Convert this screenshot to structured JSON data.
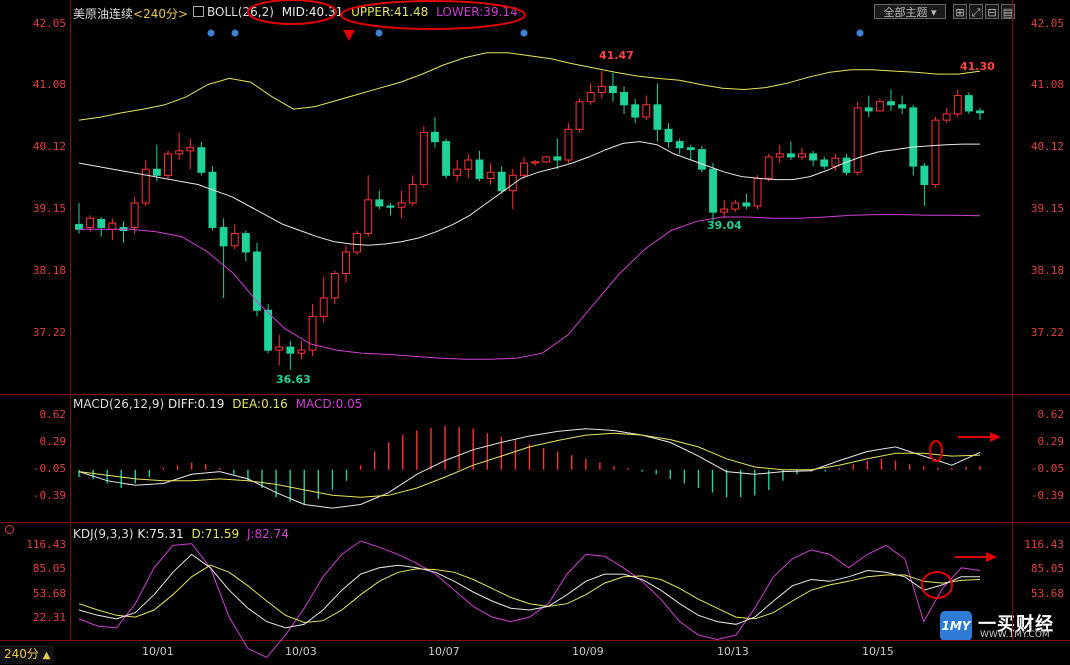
{
  "header": {
    "instrument": "美原油连续",
    "period": "<240分>",
    "indicator": "BOLL(26,2)",
    "mid_label": "MID:40.31",
    "upper_label": "UPPER:41.48",
    "lower_label": "LOWER:39.14",
    "theme_button": "全部主题",
    "theme_icon": "dropdown-arrow-icon"
  },
  "macd_header": {
    "title": "MACD(26,12,9)",
    "diff": "DIFF:0.19",
    "dea": "DEA:0.16",
    "macd": "MACD:0.05"
  },
  "kdj_header": {
    "title": "KDJ(9,3,3)",
    "k": "K:75.31",
    "d": "D:71.59",
    "j": "J:82.74"
  },
  "footer": {
    "period_button": "240分",
    "arrow": "▲"
  },
  "logo": {
    "badge": "1MY",
    "name": "一买财经",
    "url": "WWW.1MY.COM"
  },
  "price_ticks": [
    "42.05",
    "41.08",
    "40.12",
    "39.15",
    "38.18",
    "37.22"
  ],
  "macd_ticks": [
    "0.62",
    "0.29",
    "-0.05",
    "-0.39"
  ],
  "kdj_ticks": [
    "116.43",
    "85.05",
    "53.68",
    "22.31"
  ],
  "x_labels": [
    "10/01",
    "10/03",
    "10/07",
    "10/09",
    "10/13",
    "10/15"
  ],
  "annotations": {
    "high1": "41.47",
    "low1": "36.63",
    "low2": "39.04",
    "high2": "41.30"
  },
  "colors": {
    "up": "#ff3333",
    "down": "#1fd39a",
    "mid": "#e8e8e8",
    "upper": "#e6e65a",
    "lower": "#d040d0",
    "dea": "#e6e65a",
    "markup": "#e00000"
  },
  "chart_data": [
    {
      "type": "candlestick",
      "title": "美原油连续 240分 BOLL(26,2)",
      "ylim": [
        36.3,
        42.3
      ],
      "candles": [
        [
          39.0,
          38.92,
          39.35,
          38.85
        ],
        [
          38.95,
          39.1,
          39.15,
          38.88
        ],
        [
          39.08,
          38.95,
          39.12,
          38.8
        ],
        [
          38.92,
          39.02,
          39.1,
          38.75
        ],
        [
          38.95,
          38.9,
          39.05,
          38.7
        ],
        [
          38.95,
          39.35,
          39.45,
          38.85
        ],
        [
          39.35,
          39.9,
          40.05,
          39.3
        ],
        [
          39.9,
          39.8,
          40.3,
          39.7
        ],
        [
          39.8,
          40.15,
          40.2,
          39.75
        ],
        [
          40.15,
          40.2,
          40.5,
          40.05
        ],
        [
          40.2,
          40.25,
          40.4,
          39.9
        ],
        [
          40.25,
          39.85,
          40.35,
          39.8
        ],
        [
          39.85,
          38.95,
          39.95,
          38.9
        ],
        [
          38.95,
          38.65,
          39.1,
          37.8
        ],
        [
          38.65,
          38.85,
          39.0,
          38.6
        ],
        [
          38.85,
          38.55,
          38.9,
          38.4
        ],
        [
          38.55,
          37.6,
          38.7,
          37.5
        ],
        [
          37.6,
          36.95,
          37.7,
          36.9
        ],
        [
          36.95,
          37.0,
          37.2,
          36.7
        ],
        [
          37.0,
          36.9,
          37.1,
          36.63
        ],
        [
          36.9,
          36.95,
          37.1,
          36.8
        ],
        [
          36.95,
          37.5,
          37.7,
          36.85
        ],
        [
          37.5,
          37.8,
          38.15,
          37.4
        ],
        [
          37.8,
          38.2,
          38.25,
          37.7
        ],
        [
          38.2,
          38.55,
          38.65,
          38.05
        ],
        [
          38.55,
          38.85,
          38.9,
          38.5
        ],
        [
          38.85,
          39.4,
          39.8,
          38.8
        ],
        [
          39.4,
          39.3,
          39.55,
          39.25
        ],
        [
          39.3,
          39.28,
          39.35,
          39.15
        ],
        [
          39.28,
          39.35,
          39.55,
          39.1
        ],
        [
          39.35,
          39.65,
          39.8,
          39.3
        ],
        [
          39.65,
          40.5,
          40.6,
          39.6
        ],
        [
          40.5,
          40.35,
          40.75,
          40.25
        ],
        [
          40.35,
          39.8,
          40.4,
          39.75
        ],
        [
          39.8,
          39.9,
          40.05,
          39.7
        ],
        [
          39.9,
          40.05,
          40.15,
          39.75
        ],
        [
          40.05,
          39.75,
          40.2,
          39.7
        ],
        [
          39.75,
          39.85,
          40.0,
          39.65
        ],
        [
          39.85,
          39.55,
          39.95,
          39.5
        ],
        [
          39.55,
          39.8,
          39.9,
          39.25
        ],
        [
          39.8,
          40.0,
          40.1,
          39.75
        ],
        [
          40.0,
          40.02,
          40.05,
          39.95
        ],
        [
          40.02,
          40.1,
          40.12,
          40.0
        ],
        [
          40.1,
          40.05,
          40.4,
          39.9
        ],
        [
          40.05,
          40.55,
          40.65,
          40.0
        ],
        [
          40.55,
          41.0,
          41.05,
          40.5
        ],
        [
          41.0,
          41.15,
          41.3,
          40.95
        ],
        [
          41.15,
          41.25,
          41.5,
          41.05
        ],
        [
          41.25,
          41.15,
          41.47,
          41.0
        ],
        [
          41.15,
          40.95,
          41.25,
          40.8
        ],
        [
          40.95,
          40.75,
          41.05,
          40.65
        ],
        [
          40.75,
          40.95,
          41.1,
          40.7
        ],
        [
          40.95,
          40.55,
          41.3,
          40.35
        ],
        [
          40.55,
          40.35,
          40.65,
          40.25
        ],
        [
          40.35,
          40.25,
          40.4,
          40.15
        ],
        [
          40.25,
          40.22,
          40.3,
          40.05
        ],
        [
          40.22,
          39.9,
          40.28,
          39.85
        ],
        [
          39.9,
          39.2,
          40.0,
          39.04
        ],
        [
          39.2,
          39.25,
          39.4,
          39.1
        ],
        [
          39.25,
          39.35,
          39.4,
          39.2
        ],
        [
          39.35,
          39.3,
          39.5,
          39.25
        ],
        [
          39.3,
          39.75,
          39.8,
          39.25
        ],
        [
          39.75,
          40.1,
          40.15,
          39.7
        ],
        [
          40.1,
          40.15,
          40.3,
          40.0
        ],
        [
          40.15,
          40.1,
          40.35,
          40.05
        ],
        [
          40.1,
          40.15,
          40.25,
          40.05
        ],
        [
          40.15,
          40.05,
          40.2,
          39.95
        ],
        [
          40.05,
          39.95,
          40.1,
          39.9
        ],
        [
          39.95,
          40.08,
          40.15,
          39.88
        ],
        [
          40.08,
          39.85,
          40.15,
          39.8
        ],
        [
          39.85,
          40.9,
          41.0,
          39.8
        ],
        [
          40.9,
          40.85,
          41.1,
          40.75
        ],
        [
          40.85,
          41.0,
          41.05,
          40.9
        ],
        [
          41.0,
          40.95,
          41.2,
          40.85
        ],
        [
          40.95,
          40.9,
          41.1,
          40.8
        ],
        [
          40.9,
          39.95,
          40.95,
          39.8
        ],
        [
          39.95,
          39.65,
          40.0,
          39.3
        ],
        [
          39.65,
          40.7,
          40.75,
          39.6
        ],
        [
          40.7,
          40.8,
          40.9,
          40.65
        ],
        [
          40.8,
          41.1,
          41.2,
          40.75
        ],
        [
          41.1,
          40.85,
          41.15,
          40.8
        ],
        [
          40.85,
          40.82,
          40.9,
          40.7
        ]
      ],
      "boll_mid": [
        40.0,
        39.95,
        39.9,
        39.85,
        39.8,
        39.75,
        39.7,
        39.65,
        39.55,
        39.45,
        39.3,
        39.15,
        39.0,
        38.9,
        38.8,
        38.72,
        38.68,
        38.66,
        38.68,
        38.72,
        38.78,
        38.88,
        39.0,
        39.15,
        39.35,
        39.55,
        39.75,
        39.85,
        39.92,
        40.0,
        40.1,
        40.22,
        40.32,
        40.35,
        40.3,
        40.15,
        40.05,
        39.95,
        39.85,
        39.78,
        39.75,
        39.73,
        39.73,
        39.78,
        39.88,
        40.0,
        40.1,
        40.18,
        40.22,
        40.26,
        40.28,
        40.3,
        40.31,
        40.31
      ],
      "boll_upper": [
        40.7,
        40.75,
        40.82,
        40.88,
        40.95,
        41.08,
        41.28,
        41.38,
        41.32,
        41.08,
        40.88,
        40.92,
        41.02,
        41.12,
        41.22,
        41.32,
        41.45,
        41.6,
        41.72,
        41.8,
        41.8,
        41.75,
        41.7,
        41.62,
        41.55,
        41.48,
        41.42,
        41.38,
        41.35,
        41.28,
        41.22,
        41.2,
        41.23,
        41.3,
        41.4,
        41.48,
        41.52,
        41.52,
        41.5,
        41.48,
        41.45,
        41.45,
        41.5
      ],
      "boll_lower": [
        38.92,
        38.92,
        38.92,
        38.88,
        38.8,
        38.55,
        38.2,
        37.7,
        37.3,
        37.05,
        36.95,
        36.9,
        36.88,
        36.85,
        36.82,
        36.8,
        36.8,
        36.82,
        36.9,
        37.2,
        37.7,
        38.2,
        38.6,
        38.9,
        39.05,
        39.12,
        39.12,
        39.1,
        39.1,
        39.12,
        39.15,
        39.16,
        39.16,
        39.15,
        39.15,
        39.14
      ]
    },
    {
      "type": "line",
      "title": "MACD(26,12,9)",
      "ylim": [
        -0.55,
        0.72
      ],
      "series": [
        {
          "name": "DIFF",
          "values": [
            -0.02,
            -0.12,
            -0.17,
            -0.15,
            -0.05,
            -0.02,
            -0.1,
            -0.25,
            -0.38,
            -0.42,
            -0.38,
            -0.25,
            -0.05,
            0.1,
            0.22,
            0.3,
            0.37,
            0.42,
            0.45,
            0.43,
            0.38,
            0.3,
            0.15,
            -0.02,
            -0.05,
            -0.02,
            -0.01,
            0.1,
            0.2,
            0.25,
            0.15,
            0.05,
            0.19
          ]
        },
        {
          "name": "DEA",
          "values": [
            -0.02,
            -0.06,
            -0.1,
            -0.12,
            -0.12,
            -0.1,
            -0.12,
            -0.16,
            -0.22,
            -0.28,
            -0.3,
            -0.28,
            -0.2,
            -0.08,
            0.05,
            0.15,
            0.25,
            0.32,
            0.38,
            0.4,
            0.38,
            0.33,
            0.25,
            0.12,
            0.03,
            0.0,
            0.0,
            0.05,
            0.12,
            0.18,
            0.18,
            0.15,
            0.16
          ]
        },
        {
          "name": "MACD",
          "values": [
            -0.08,
            -0.1,
            -0.15,
            -0.2,
            -0.15,
            -0.08,
            0.02,
            0.05,
            0.08,
            0.06,
            0.02,
            -0.05,
            -0.12,
            -0.2,
            -0.3,
            -0.35,
            -0.38,
            -0.32,
            -0.22,
            -0.12,
            0.05,
            0.2,
            0.3,
            0.38,
            0.43,
            0.46,
            0.48,
            0.47,
            0.45,
            0.4,
            0.36,
            0.32,
            0.28,
            0.24,
            0.2,
            0.16,
            0.12,
            0.08,
            0.04,
            0.02,
            -0.02,
            -0.05,
            -0.1,
            -0.15,
            -0.2,
            -0.25,
            -0.3,
            -0.3,
            -0.28,
            -0.22,
            -0.12,
            -0.05,
            -0.02,
            -0.02,
            0.02,
            0.06,
            0.1,
            0.12,
            0.1,
            0.06,
            0.04,
            0.02,
            0.02,
            0.03,
            0.04
          ]
        }
      ]
    },
    {
      "type": "line",
      "title": "KDJ(9,3,3)",
      "ylim": [
        0,
        125
      ],
      "series": [
        {
          "name": "K",
          "values": [
            38,
            32,
            28,
            35,
            55,
            80,
            100,
            85,
            60,
            40,
            25,
            18,
            22,
            38,
            60,
            78,
            85,
            88,
            85,
            80,
            70,
            58,
            48,
            40,
            38,
            42,
            55,
            70,
            78,
            78,
            72,
            60,
            45,
            32,
            25,
            22,
            30,
            48,
            65,
            72,
            70,
            75,
            82,
            80,
            75,
            60,
            66,
            75,
            75
          ]
        },
        {
          "name": "D",
          "values": [
            45,
            38,
            32,
            30,
            38,
            55,
            75,
            88,
            80,
            65,
            48,
            32,
            24,
            26,
            38,
            55,
            70,
            80,
            84,
            83,
            80,
            72,
            62,
            52,
            45,
            42,
            45,
            55,
            68,
            75,
            76,
            72,
            62,
            50,
            40,
            30,
            28,
            35,
            48,
            60,
            66,
            70,
            75,
            77,
            77,
            70,
            68,
            71,
            72
          ]
        },
        {
          "name": "J",
          "values": [
            28,
            20,
            18,
            45,
            85,
            110,
            112,
            85,
            30,
            -5,
            -15,
            10,
            40,
            75,
            100,
            115,
            108,
            100,
            90,
            78,
            60,
            42,
            30,
            25,
            30,
            45,
            78,
            100,
            98,
            85,
            70,
            50,
            25,
            10,
            5,
            10,
            40,
            75,
            95,
            105,
            100,
            85,
            100,
            110,
            95,
            25,
            62,
            85,
            82
          ]
        }
      ]
    }
  ]
}
